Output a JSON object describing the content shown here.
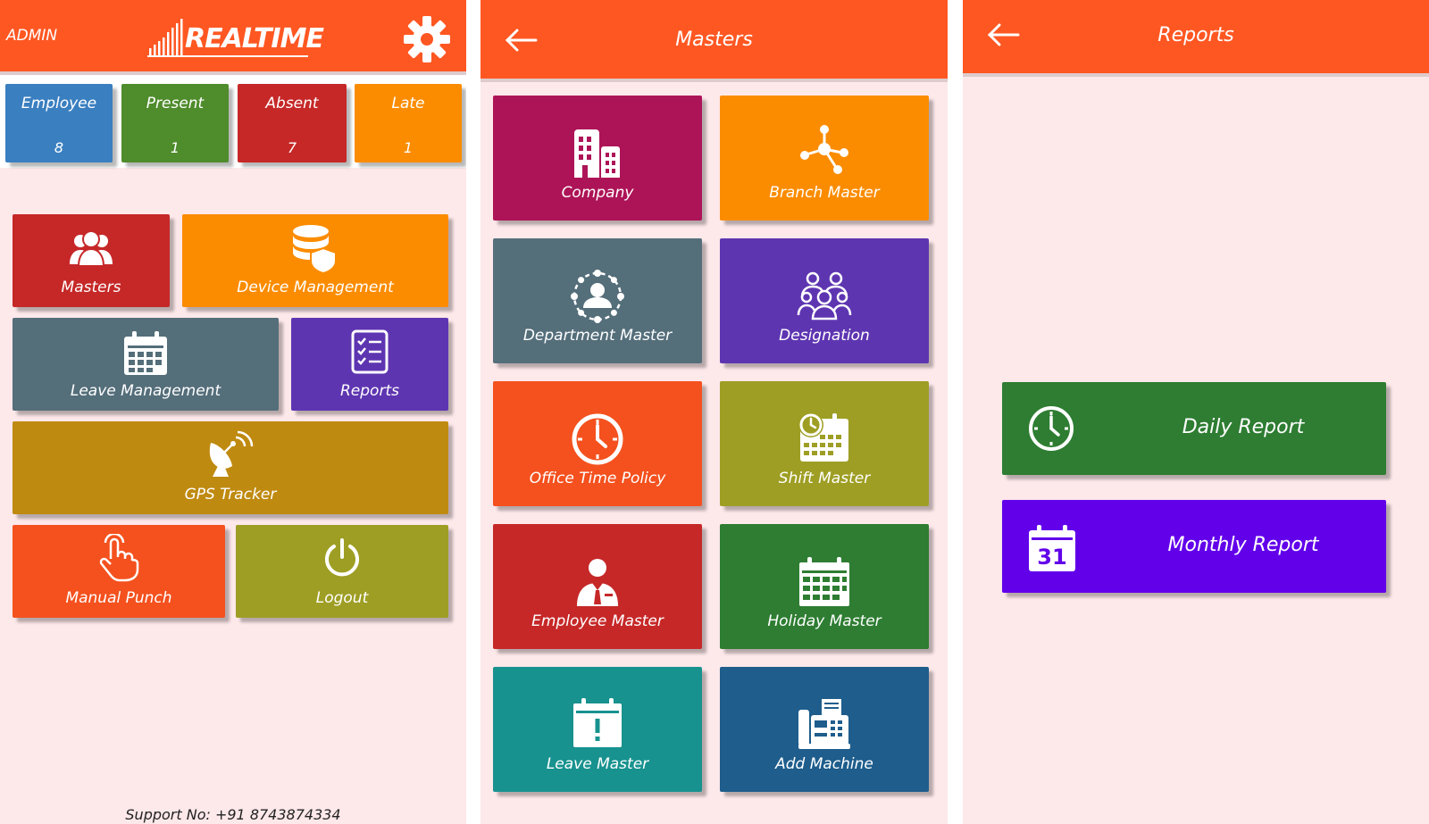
{
  "dashboard": {
    "user": "ADMIN",
    "logo": "REALTIME",
    "stats": [
      {
        "label": "Employee",
        "value": "8",
        "color": "#3a7fc0"
      },
      {
        "label": "Present",
        "value": "1",
        "color": "#4f8c2c"
      },
      {
        "label": "Absent",
        "value": "7",
        "color": "#c62828"
      },
      {
        "label": "Late",
        "value": "1",
        "color": "#fb8c00"
      }
    ],
    "tiles": {
      "masters": "Masters",
      "device_management": "Device Management",
      "leave_management": "Leave Management",
      "reports": "Reports",
      "gps_tracker": "GPS Tracker",
      "manual_punch": "Manual Punch",
      "logout": "Logout"
    },
    "support": "Support No: +91 8743874334"
  },
  "masters_screen": {
    "title": "Masters",
    "tiles": {
      "company": "Company",
      "branch_master": "Branch Master",
      "department_master": "Department Master",
      "designation": "Designation",
      "office_time_policy": "Office Time Policy",
      "shift_master": "Shift Master",
      "employee_master": "Employee Master",
      "holiday_master": "Holiday Master",
      "leave_master": "Leave Master",
      "add_machine": "Add Machine"
    }
  },
  "reports_screen": {
    "title": "Reports",
    "daily_report": "Daily Report",
    "monthly_report": "Monthly Report",
    "calendar_day": "31"
  },
  "colors": {
    "primary": "#ff5722",
    "background": "#fde8ea",
    "crimson": "#c62828",
    "orange": "#fb8c00",
    "slate": "#546e7a",
    "purple": "#5e35b1",
    "olive": "#b8860b",
    "deep_orange": "#f4511e",
    "yellow_green": "#9e9e24",
    "magenta": "#ad1457",
    "green": "#2e7d32",
    "teal": "#17928f",
    "navy": "#1e5d8c",
    "violet": "#6200ea"
  },
  "icons": [
    "settings-gear-icon",
    "back-arrow-icon",
    "users-icon",
    "database-shield-icon",
    "calendar-icon",
    "checklist-icon",
    "satellite-dish-icon",
    "hand-pointer-icon",
    "power-icon",
    "building-icon",
    "network-icon",
    "department-icon",
    "group-icon",
    "clock-icon",
    "calendar-clock-icon",
    "employee-icon",
    "calendar-grid-icon",
    "calendar-alert-icon",
    "fax-machine-icon",
    "calendar-31-icon"
  ]
}
